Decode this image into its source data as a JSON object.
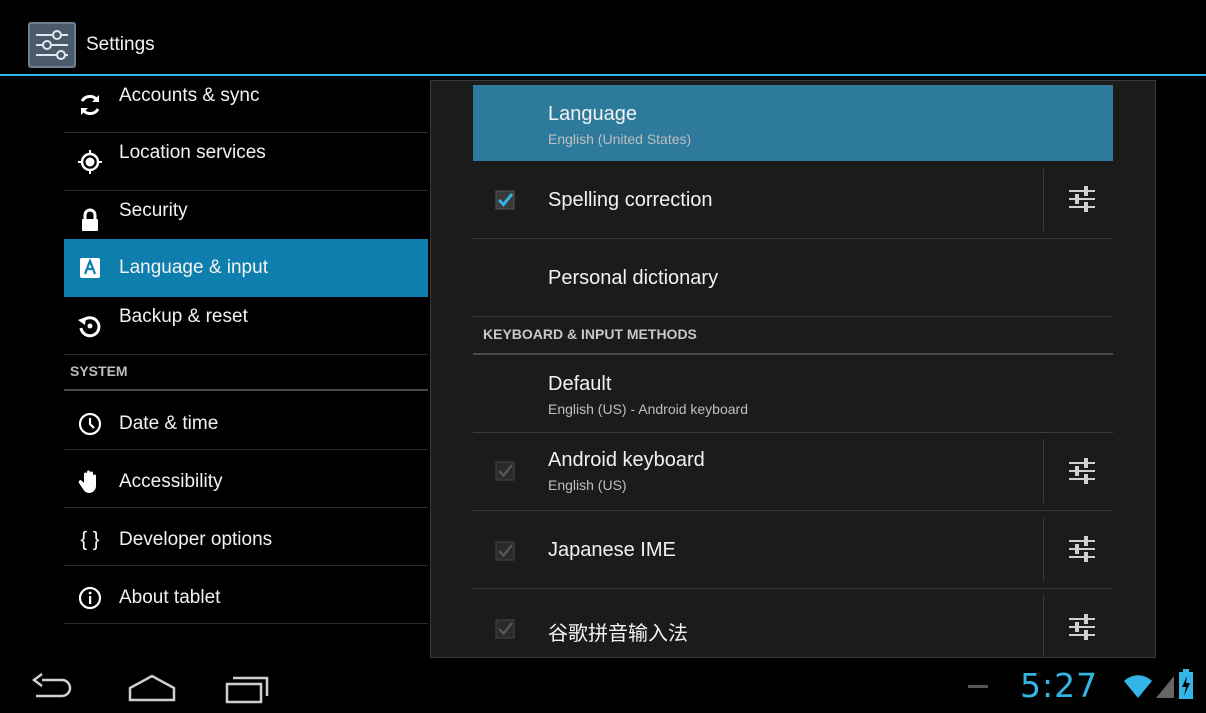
{
  "app": {
    "title": "Settings"
  },
  "left": {
    "items": [
      {
        "label": "Accounts & sync",
        "icon": "sync-icon"
      },
      {
        "label": "Location services",
        "icon": "location-icon"
      },
      {
        "label": "Security",
        "icon": "lock-icon"
      },
      {
        "label": "Language & input",
        "icon": "language-icon",
        "selected": true
      },
      {
        "label": "Backup & reset",
        "icon": "backup-icon"
      }
    ],
    "system_header": "SYSTEM",
    "system_items": [
      {
        "label": "Date & time",
        "icon": "clock-icon"
      },
      {
        "label": "Accessibility",
        "icon": "hand-icon"
      },
      {
        "label": "Developer options",
        "icon": "braces-icon"
      },
      {
        "label": "About tablet",
        "icon": "info-icon"
      }
    ]
  },
  "right": {
    "language": {
      "title": "Language",
      "subtitle": "English (United States)"
    },
    "spelling": {
      "title": "Spelling correction",
      "checked": true
    },
    "dictionary": {
      "title": "Personal dictionary"
    },
    "keyboard_header": "KEYBOARD & INPUT METHODS",
    "default": {
      "title": "Default",
      "subtitle": "English (US) - Android keyboard"
    },
    "android_keyboard": {
      "title": "Android keyboard",
      "subtitle": "English (US)",
      "checked": true
    },
    "japanese": {
      "title": "Japanese IME",
      "checked": true
    },
    "pinyin": {
      "title": "谷歌拼音输入法",
      "checked": true
    }
  },
  "status": {
    "time": "5:27",
    "accent": "#33b5e5"
  },
  "colors": {
    "selected_left": "#0e7eae",
    "selected_right": "#2d7a9c"
  }
}
